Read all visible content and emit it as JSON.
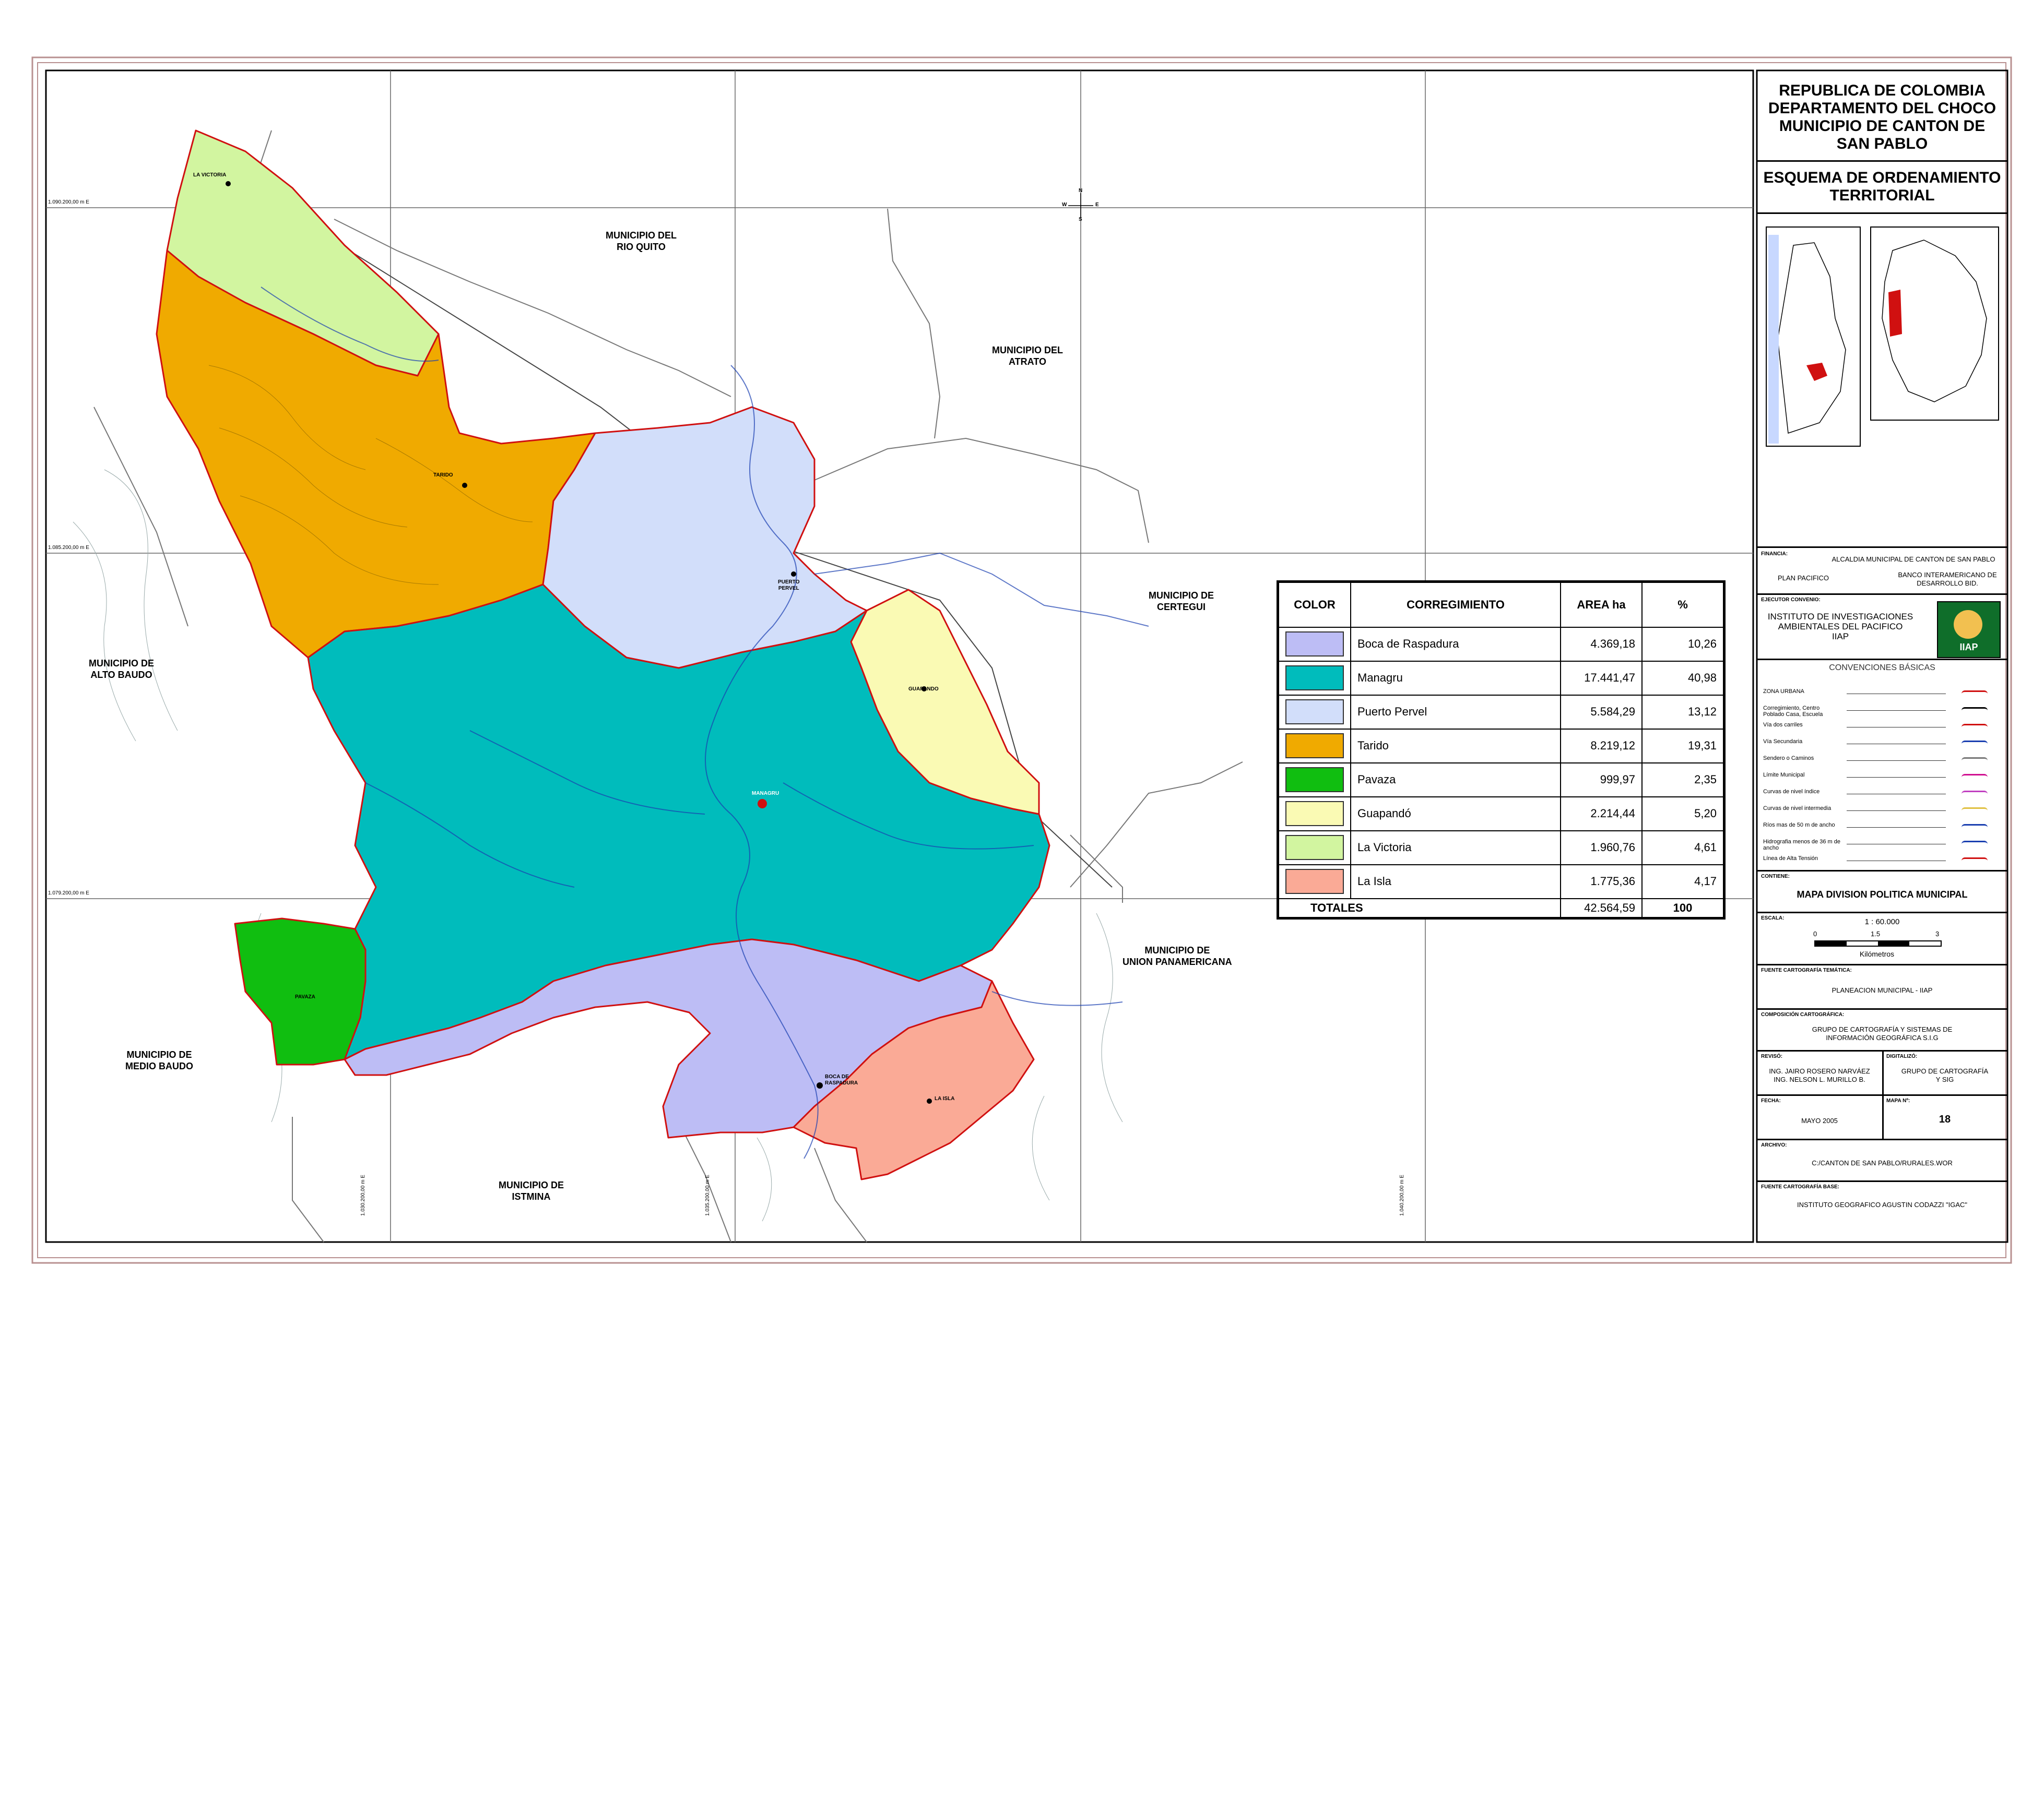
{
  "header": {
    "title_lines": [
      "REPUBLICA DE COLOMBIA",
      "DEPARTAMENTO DEL CHOCO",
      "MUNICIPIO DE CANTON DE",
      "SAN PABLO"
    ],
    "subtitle_lines": [
      "ESQUEMA DE ORDENAMIENTO",
      "TERRITORIAL"
    ]
  },
  "legend": {
    "headers": {
      "color": "COLOR",
      "corregimiento": "CORREGIMIENTO",
      "area": "AREA ha",
      "pct": "%"
    },
    "rows": [
      {
        "name": "Boca de Raspadura",
        "area": "4.369,18",
        "pct": "10,26",
        "color": "#bdbdf5"
      },
      {
        "name": "Managru",
        "area": "17.441,47",
        "pct": "40,98",
        "color": "#00bcbc"
      },
      {
        "name": "Puerto Pervel",
        "area": "5.584,29",
        "pct": "13,12",
        "color": "#d2defa"
      },
      {
        "name": "Tarido",
        "area": "8.219,12",
        "pct": "19,31",
        "color": "#f0aa00"
      },
      {
        "name": "Pavaza",
        "area": "999,97",
        "pct": "2,35",
        "color": "#10be10"
      },
      {
        "name": "Guapandó",
        "area": "2.214,44",
        "pct": "5,20",
        "color": "#fafab4"
      },
      {
        "name": "La Victoria",
        "area": "1.960,76",
        "pct": "4,61",
        "color": "#d2f5a0"
      },
      {
        "name": "La Isla",
        "area": "1.775,36",
        "pct": "4,17",
        "color": "#faaa96"
      }
    ],
    "totals_label": "TOTALES",
    "totals_area": "42.564,59",
    "totals_pct": "100"
  },
  "municipalities": {
    "rio_quito": [
      "MUNICIPIO DEL",
      "RIO QUITO"
    ],
    "atrato": [
      "MUNICIPIO DEL",
      "ATRATO"
    ],
    "certegui": [
      "MUNICIPIO DE",
      "CERTEGUI"
    ],
    "alto_baudo": [
      "MUNICIPIO DE",
      "ALTO BAUDO"
    ],
    "medio_baudo": [
      "MUNICIPIO DE",
      "MEDIO BAUDO"
    ],
    "union_panamericana": [
      "MUNICIPIO DE",
      "UNION PANAMERICANA"
    ],
    "istmina": [
      "MUNICIPIO DE",
      "ISTMINA"
    ]
  },
  "places": {
    "la_victoria": "LA VICTORIA",
    "tarido": "TARIDO",
    "puerto_pervel": [
      "PUERTO",
      "PERVEL"
    ],
    "guapando": "GUAPANDO",
    "managru": "MANAGRU",
    "pavaza": "PAVAZA",
    "boca_raspadura": [
      "BOCA DE",
      "RASPADURA"
    ],
    "la_isla": "LA ISLA"
  },
  "grid_labels": {
    "n1": "1.090.200,00 m E",
    "n2": "1.085.200,00 m E",
    "n3": "1.079.200,00 m E",
    "e1": "1.030.200,00 m E",
    "e2": "1.035.200,00 m E",
    "e3": "1.040.200,00 m E"
  },
  "panel": {
    "financia_label": "FINANCIA:",
    "financia_1": "ALCALDIA MUNICIPAL DE CANTON DE SAN PABLO",
    "financia_2": "PLAN PACIFICO",
    "financia_3": [
      "BANCO INTERAMERICANO DE",
      "DESARROLLO BID."
    ],
    "ejecutor_label": "EJECUTOR CONVENIO:",
    "ejecutor_lines": [
      "INSTITUTO DE INVESTIGACIONES",
      "AMBIENTALES DEL PACIFICO",
      "IIAP"
    ],
    "logo_text": "IIAP",
    "convenciones_title": "CONVENCIONES BÁSICAS",
    "convenciones": [
      "ZONA URBANA",
      "Corregimiento, Centro Poblado Casa, Escuela",
      "Vía dos carriles",
      "Vía Secundaria",
      "Sendero o Caminos",
      "Límite Municipal",
      "Curvas de nivel índice",
      "Curvas de nivel intermedia",
      "Ríos mas de 50 m de ancho",
      "Hidrografia menos de 36 m de ancho",
      "Línea de Alta Tensión"
    ],
    "contiene_label": "CONTIENE:",
    "contiene": "MAPA DIVISION POLITICA MUNICIPAL",
    "escala_label": "ESCALA:",
    "escala": "1 : 60.000",
    "scale_ticks": [
      "0",
      "1.5",
      "3"
    ],
    "scale_unit": "Kilómetros",
    "fuente_tematica_label": "FUENTE CARTOGRAFÍA TEMÁTICA:",
    "fuente_tematica": "PLANEACION MUNICIPAL - IIAP",
    "composicion_label": "COMPOSICIÓN CARTOGRÁFICA:",
    "composicion": [
      "GRUPO DE CARTOGRAFÍA Y SISTEMAS DE",
      "INFORMACIÓN GEOGRÁFICA S.I.G"
    ],
    "reviso_label": "REVISÓ:",
    "reviso": [
      "ING. JAIRO ROSERO NARVÁEZ",
      "ING. NELSON L. MURILLO B."
    ],
    "digitalizo_label": "DIGITALIZÓ:",
    "digitalizo": [
      "GRUPO DE CARTOGRAFÍA",
      "Y SIG"
    ],
    "fecha_label": "FECHA:",
    "fecha": "MAYO 2005",
    "mapa_label": "MAPA Nº:",
    "mapa_no": "18",
    "archivo_label": "ARCHIVO:",
    "archivo": "C:/CANTON DE SAN PABLO/RURALES.WOR",
    "fuente_base_label": "FUENTE CARTOGRAFÍA BASE:",
    "fuente_base": "INSTITUTO GEOGRAFICO AGUSTIN CODAZZI \"IGAC\""
  },
  "compass": {
    "n": "N",
    "s": "S",
    "e": "E",
    "w": "W"
  }
}
